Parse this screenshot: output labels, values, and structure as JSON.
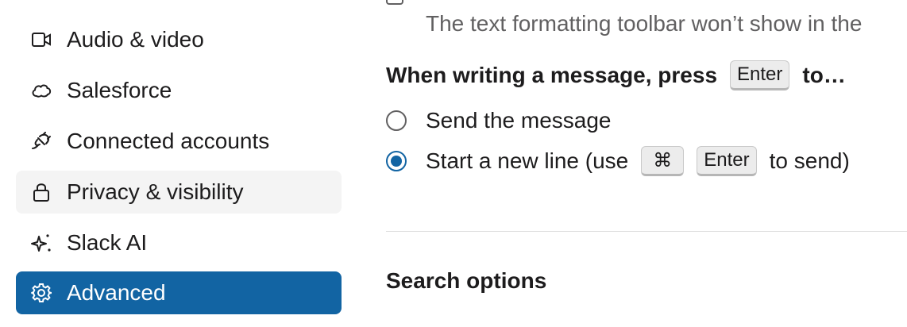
{
  "sidebar": {
    "items": [
      {
        "label": "Audio & video",
        "icon": "video-camera-icon",
        "state": "normal"
      },
      {
        "label": "Salesforce",
        "icon": "cloud-icon",
        "state": "normal"
      },
      {
        "label": "Connected accounts",
        "icon": "plug-icon",
        "state": "normal"
      },
      {
        "label": "Privacy & visibility",
        "icon": "lock-icon",
        "state": "hover"
      },
      {
        "label": "Slack AI",
        "icon": "sparkle-icon",
        "state": "normal"
      },
      {
        "label": "Advanced",
        "icon": "gear-icon",
        "state": "active"
      }
    ]
  },
  "main": {
    "formatting_hint": "The text formatting toolbar won’t show in the",
    "enter_section": {
      "title_prefix": "When writing a message, press",
      "key": "Enter",
      "title_suffix": "to…",
      "options": [
        {
          "label": "Send the message",
          "checked": false
        },
        {
          "label_prefix": "Start a new line (use",
          "key1": "⌘",
          "key2": "Enter",
          "label_suffix": "to send)",
          "checked": true
        }
      ]
    },
    "search_section": {
      "title": "Search options"
    }
  },
  "colors": {
    "accent": "#1264a3",
    "hover_bg": "#f4f4f4",
    "text": "#1d1c1d",
    "muted": "#616061"
  }
}
